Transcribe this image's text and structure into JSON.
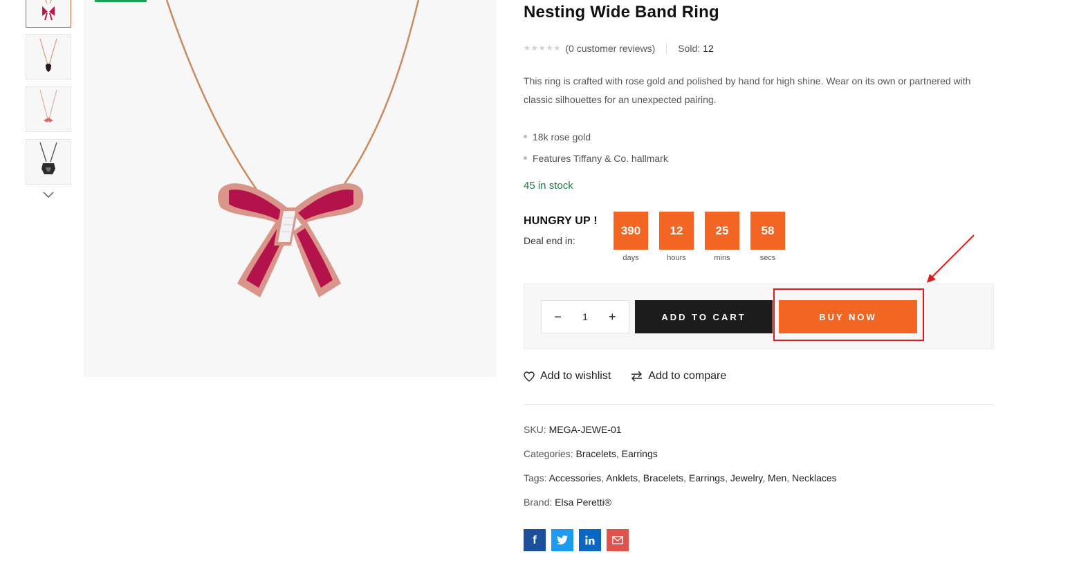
{
  "product": {
    "title": "Nesting Wide Band Ring",
    "reviews_text": "(0 customer reviews)",
    "sold_label": "Sold:",
    "sold_value": "12",
    "description": "This ring is crafted with rose gold and polished by hand for high shine. Wear on its own or partnered with classic silhouettes for an unexpected pairing.",
    "features": [
      "18k rose gold",
      "Features Tiffany & Co. hallmark"
    ],
    "stock": "45 in stock",
    "rating": 0
  },
  "countdown": {
    "heading": "HUNGRY UP !",
    "subheading": "Deal end in:",
    "units": [
      {
        "value": "390",
        "label": "days"
      },
      {
        "value": "12",
        "label": "hours"
      },
      {
        "value": "25",
        "label": "mins"
      },
      {
        "value": "58",
        "label": "secs"
      }
    ]
  },
  "cart": {
    "minus": "−",
    "plus": "+",
    "quantity": "1",
    "add_to_cart": "ADD TO CART",
    "buy_now": "BUY NOW"
  },
  "actions": {
    "wishlist": "Add to wishlist",
    "compare": "Add to compare"
  },
  "meta": {
    "sku_label": "SKU:",
    "sku": "MEGA-JEWE-01",
    "categories_label": "Categories:",
    "categories": [
      "Bracelets",
      "Earrings"
    ],
    "tags_label": "Tags:",
    "tags": [
      "Accessories",
      "Anklets",
      "Bracelets",
      "Earrings",
      "Jewelry",
      "Men",
      "Necklaces"
    ],
    "brand_label": "Brand:",
    "brand": "Elsa Peretti®"
  },
  "social": {
    "facebook": "f",
    "colors": {
      "facebook": "#1b4e9b",
      "twitter": "#1d9bf0",
      "linkedin": "#0a66c2",
      "email": "#e0524b"
    }
  },
  "colors": {
    "accent": "#f26522",
    "dark_button": "#1c1c1c",
    "stock_green": "#1f7a4a",
    "highlight": "#e11b1b"
  },
  "icons": [
    "chevron-down-icon",
    "heart-icon",
    "compare-icon",
    "star-icon",
    "facebook-icon",
    "twitter-icon",
    "linkedin-icon",
    "email-icon",
    "annotation-arrow"
  ]
}
